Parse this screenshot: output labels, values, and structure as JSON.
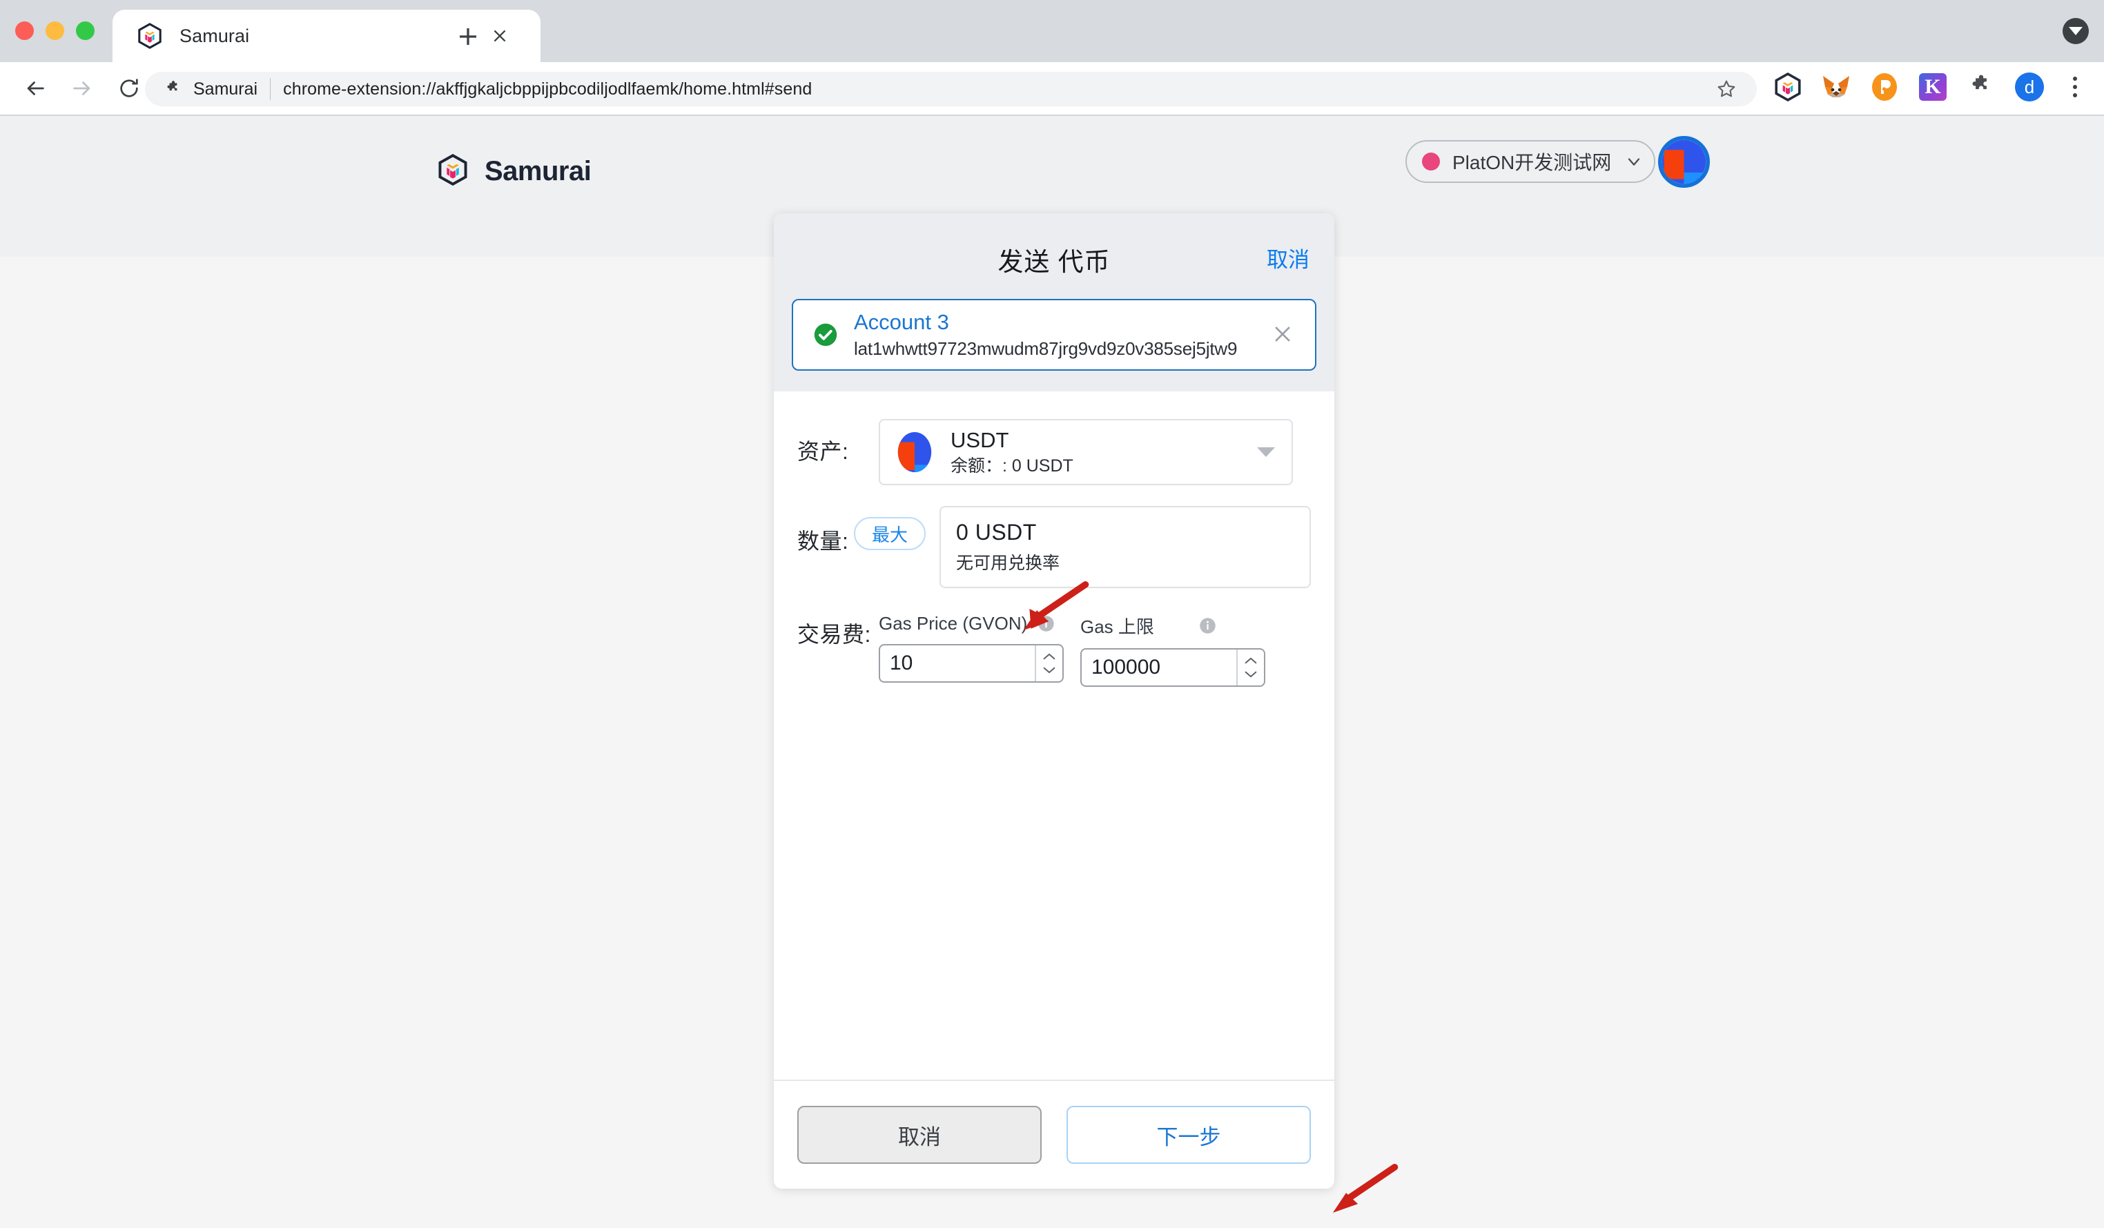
{
  "browser": {
    "tab": {
      "title": "Samurai",
      "favicon_icon": "samurai-cube-icon",
      "close_icon": "close-icon"
    },
    "new_tab_label": "+",
    "window_menu_icon": "chevron-down-circle-icon",
    "nav": {
      "back_icon": "back-arrow-icon",
      "forward_icon": "forward-arrow-icon",
      "reload_icon": "reload-icon"
    },
    "omnibox": {
      "extension_icon": "puzzle-piece-icon",
      "extension_name": "Samurai",
      "url": "chrome-extension://akffjgkaljcbppijpbcodiljodlfaemk/home.html#send",
      "star_icon": "bookmark-star-icon"
    },
    "extensions": [
      {
        "name": "samurai-extension-icon",
        "label": ""
      },
      {
        "name": "metamask-extension-icon",
        "label": ""
      },
      {
        "name": "polkadot-extension-icon",
        "label": ""
      },
      {
        "name": "keplr-extension-icon",
        "label": "K"
      },
      {
        "name": "extensions-puzzle-icon",
        "label": ""
      }
    ],
    "profile": {
      "avatar_icon": "profile-avatar",
      "initial": "d"
    },
    "menu_icon": "kebab-menu-icon"
  },
  "app_header": {
    "logo_icon": "samurai-cube-logo",
    "brand": "Samurai",
    "network": {
      "status_icon": "network-status-dot",
      "status_color": "#e8467c",
      "name": "PlatON开发测试网",
      "caret_icon": "chevron-down-icon"
    },
    "account_avatar_icon": "account-identicon"
  },
  "modal": {
    "title": "发送 代币",
    "cancel_link": "取消",
    "account": {
      "check_icon": "check-circle-icon",
      "name": "Account 3",
      "address": "lat1whwtt97723mwudm87jrg9vd9z0v385sej5jtw9",
      "close_icon": "close-icon"
    },
    "fields": {
      "asset": {
        "label": "资产:",
        "token_icon": "usdt-identicon",
        "symbol": "USDT",
        "balance": "余额：: 0 USDT",
        "caret_icon": "dropdown-caret-icon"
      },
      "amount": {
        "label": "数量:",
        "max_button": "最大",
        "value": "0 USDT",
        "sub": "无可用兑换率"
      },
      "fee": {
        "label": "交易费:",
        "gas_price": {
          "label": "Gas Price (GVON)",
          "info_icon": "info-icon",
          "value": "10"
        },
        "gas_limit": {
          "label": "Gas 上限",
          "info_icon": "info-icon",
          "value": "100000"
        }
      }
    },
    "footer": {
      "cancel": "取消",
      "next": "下一步"
    }
  },
  "annotations": {
    "arrow_color": "#cc2018",
    "arrows": [
      {
        "name": "arrow-to-amount-input",
        "target": "amount-input"
      },
      {
        "name": "arrow-to-next-button",
        "target": "next-button"
      }
    ]
  }
}
